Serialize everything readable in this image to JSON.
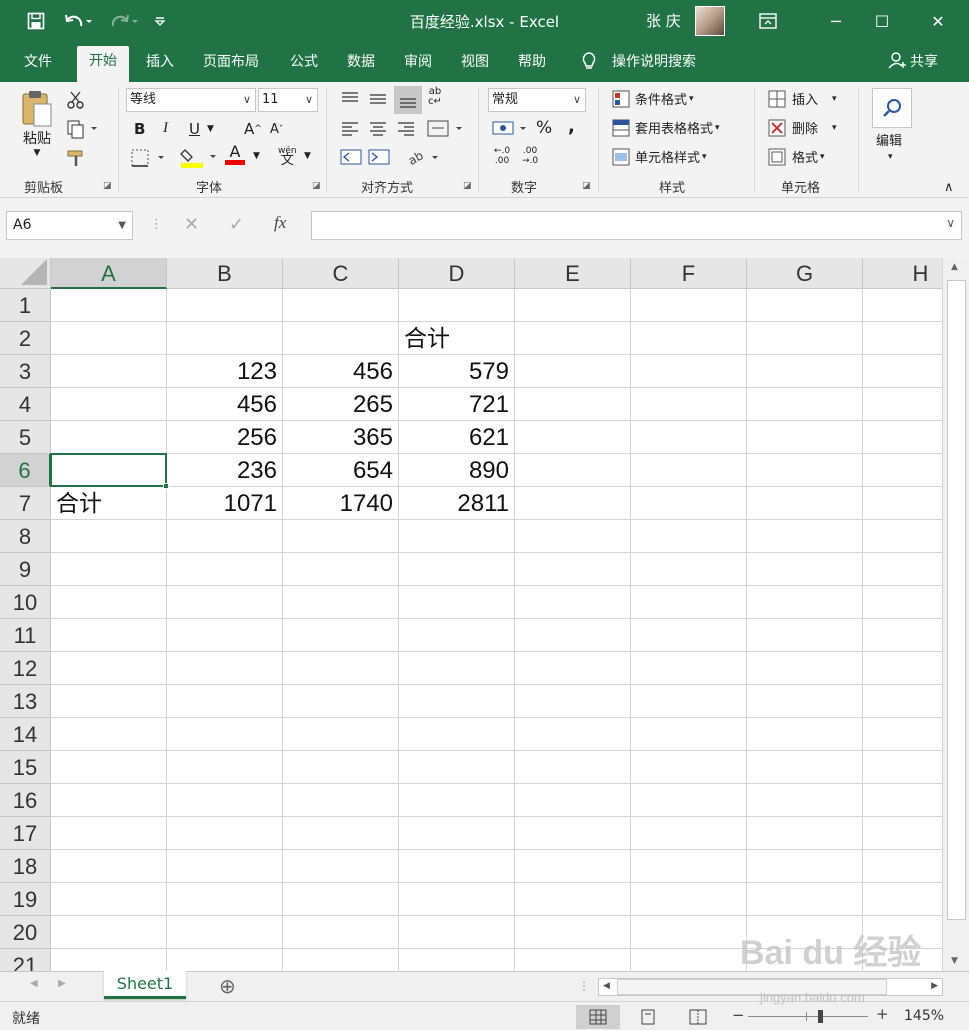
{
  "window": {
    "title": "百度经验.xlsx  -  Excel",
    "username": "张 庆",
    "controls": [
      "─",
      "☐",
      "✕"
    ],
    "ribbon_display_icon": "ribbon-display-options-icon"
  },
  "quick_access": {
    "save_icon": "save-icon",
    "undo_icon": "undo-icon",
    "redo_icon": "redo-icon",
    "customize_icon": "customize-qat-icon"
  },
  "menu": {
    "tabs": [
      "文件",
      "开始",
      "插入",
      "页面布局",
      "公式",
      "数据",
      "审阅",
      "视图",
      "帮助"
    ],
    "active_tab": "开始",
    "tell_me": "操作说明搜索",
    "share": "共享"
  },
  "ribbon": {
    "clipboard": {
      "label": "剪贴板",
      "paste": "粘贴"
    },
    "font": {
      "label": "字体",
      "font_name": "等线",
      "font_size": "11",
      "bold": "B",
      "italic": "I",
      "underline": "U",
      "grow": "A",
      "shrink": "A",
      "font_color_letter": "A",
      "phonetic": "wén"
    },
    "alignment": {
      "label": "对齐方式"
    },
    "number": {
      "label": "数字",
      "format": "常规",
      "percent": "%",
      "comma": ","
    },
    "styles": {
      "label": "样式",
      "conditional": "条件格式",
      "table": "套用表格格式",
      "cell_styles": "单元格样式"
    },
    "cells": {
      "label": "单元格",
      "insert": "插入",
      "delete": "删除",
      "format": "格式"
    },
    "editing": {
      "label": "编辑"
    }
  },
  "formula_bar": {
    "name_box": "A6",
    "cancel": "✕",
    "enter": "✓",
    "fx": "fx",
    "content": ""
  },
  "grid": {
    "columns": [
      "A",
      "B",
      "C",
      "D",
      "E",
      "F",
      "G",
      "H"
    ],
    "rows": [
      "1",
      "2",
      "3",
      "4",
      "5",
      "6",
      "7",
      "8",
      "9",
      "10",
      "11",
      "12",
      "13",
      "14",
      "15",
      "16",
      "17",
      "18",
      "19",
      "20",
      "21"
    ],
    "selected_cell": "A6",
    "cells": {
      "D2": "合计",
      "B3": "123",
      "C3": "456",
      "D3": "579",
      "B4": "456",
      "C4": "265",
      "D4": "721",
      "B5": "256",
      "C5": "365",
      "D5": "621",
      "B6": "236",
      "C6": "654",
      "D6": "890",
      "A7": "合计",
      "B7": "1071",
      "C7": "1740",
      "D7": "2811"
    }
  },
  "sheets": {
    "tabs": [
      "Sheet1"
    ],
    "add_label": "⊕"
  },
  "status": {
    "text": "就绪",
    "zoom": "145%",
    "zoom_fraction": 0.6
  },
  "watermark": {
    "logo": "Bai du 经验",
    "url": "jingyan.baidu.com"
  },
  "colors": {
    "accent": "#217346",
    "ribbon_bg": "#f3f3f3",
    "header_bg": "#e6e6e6",
    "gridline": "#d4d4d4"
  }
}
